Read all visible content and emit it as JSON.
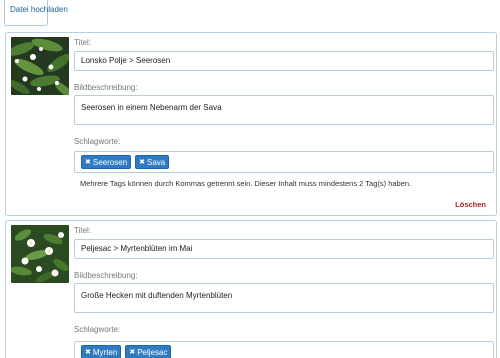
{
  "upload": {
    "label": "Datei hochladen"
  },
  "items": [
    {
      "title_label": "Titel:",
      "title_value": "Lonsko Polje  > Seerosen",
      "description_label": "Bildbeschreibung:",
      "description_value": "Seerosen in einem Nebenarm  der Sava",
      "tags_label": "Schlagworte:",
      "tags": [
        "Seerosen",
        "Sava"
      ],
      "hint": "Mehrere Tags können durch Kommas getrennt sein. Dieser Inhalt muss mindestens 2 Tag(s) haben.",
      "delete_label": "Löschen"
    },
    {
      "title_label": "Titel:",
      "title_value": "Peljesac > Myrtenblüten im Mai",
      "description_label": "Bildbeschreibung:",
      "description_value": "Große Hecken mit duftenden Myrtenblüten",
      "tags_label": "Schlagworte:",
      "tags": [
        "Myrten",
        "Peljesac"
      ]
    }
  ],
  "icons": {
    "tag_remove": "close-icon"
  },
  "colors": {
    "accent": "#2e7bc4",
    "border": "#b5cfe3",
    "delete": "#b02323",
    "link": "#1a5e92"
  }
}
